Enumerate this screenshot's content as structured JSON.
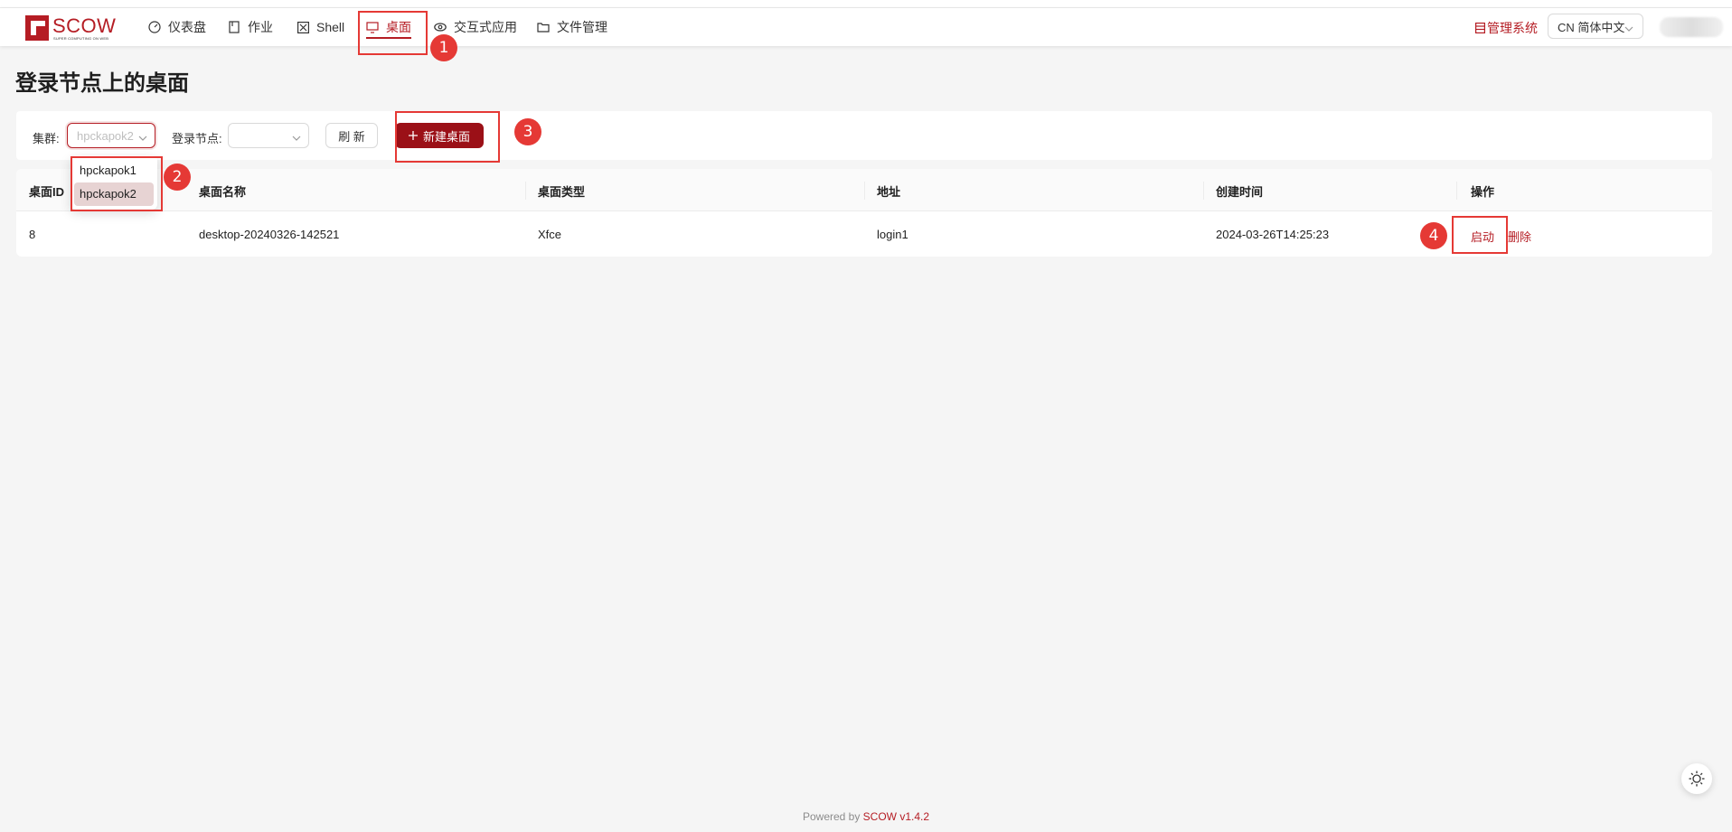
{
  "header": {
    "logo_text": "SCOW",
    "logo_subtext": "SUPER COMPUTING ON WEB",
    "nav": [
      {
        "label": "仪表盘",
        "icon": "dashboard-icon"
      },
      {
        "label": "作业",
        "icon": "file-icon"
      },
      {
        "label": "Shell",
        "icon": "terminal-icon"
      },
      {
        "label": "桌面",
        "icon": "desktop-icon",
        "active": true
      },
      {
        "label": "交互式应用",
        "icon": "eye-icon"
      },
      {
        "label": "文件管理",
        "icon": "folder-icon"
      }
    ],
    "management_link": "管理系统",
    "language": "CN 简体中文"
  },
  "page": {
    "title": "登录节点上的桌面"
  },
  "filters": {
    "cluster_label": "集群:",
    "cluster_value": "hpckapok2",
    "login_node_label": "登录节点:",
    "login_node_value": "",
    "refresh_label": "刷 新",
    "new_desktop_label": "新建桌面"
  },
  "cluster_dropdown": {
    "options": [
      "hpckapok1",
      "hpckapok2"
    ],
    "selected": "hpckapok2"
  },
  "table": {
    "columns": [
      "桌面ID",
      "桌面名称",
      "桌面类型",
      "地址",
      "创建时间",
      "操作"
    ],
    "rows": [
      {
        "id": "8",
        "name": "desktop-20240326-142521",
        "type": "Xfce",
        "address": "login1",
        "created": "2024-03-26T14:25:23",
        "actions": [
          "启动",
          "删除"
        ]
      }
    ]
  },
  "annotations": [
    "1",
    "2",
    "3",
    "4"
  ],
  "footer": {
    "prefix": "Powered by ",
    "brand": "SCOW v1.4.2"
  },
  "colors": {
    "accent": "#b51d24",
    "primary_button": "#9b1017",
    "annotation": "#e53935",
    "background": "#f5f5f5"
  }
}
